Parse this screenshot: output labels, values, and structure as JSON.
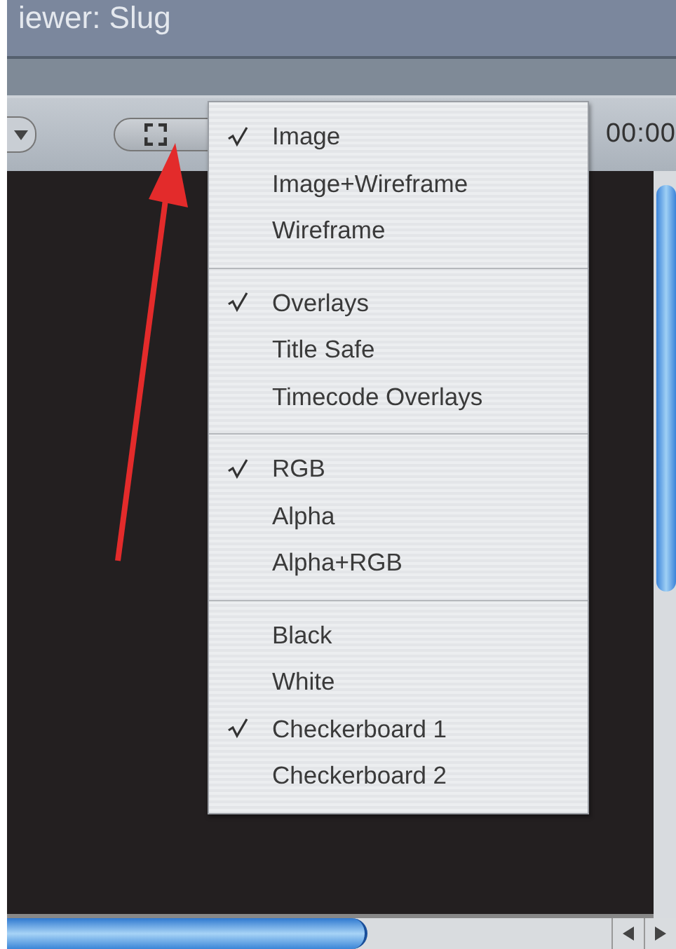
{
  "window": {
    "title": "iewer: Slug"
  },
  "toolbar": {
    "timecode": "00:00"
  },
  "menu": {
    "groups": [
      {
        "items": [
          {
            "label": "Image",
            "checked": true
          },
          {
            "label": "Image+Wireframe",
            "checked": false
          },
          {
            "label": "Wireframe",
            "checked": false
          }
        ]
      },
      {
        "items": [
          {
            "label": "Overlays",
            "checked": true
          },
          {
            "label": "Title Safe",
            "checked": false
          },
          {
            "label": "Timecode Overlays",
            "checked": false
          }
        ]
      },
      {
        "items": [
          {
            "label": "RGB",
            "checked": true
          },
          {
            "label": "Alpha",
            "checked": false
          },
          {
            "label": "Alpha+RGB",
            "checked": false
          }
        ]
      },
      {
        "items": [
          {
            "label": "Black",
            "checked": false
          },
          {
            "label": "White",
            "checked": false
          },
          {
            "label": "Checkerboard 1",
            "checked": true
          },
          {
            "label": "Checkerboard 2",
            "checked": false
          }
        ]
      }
    ]
  }
}
